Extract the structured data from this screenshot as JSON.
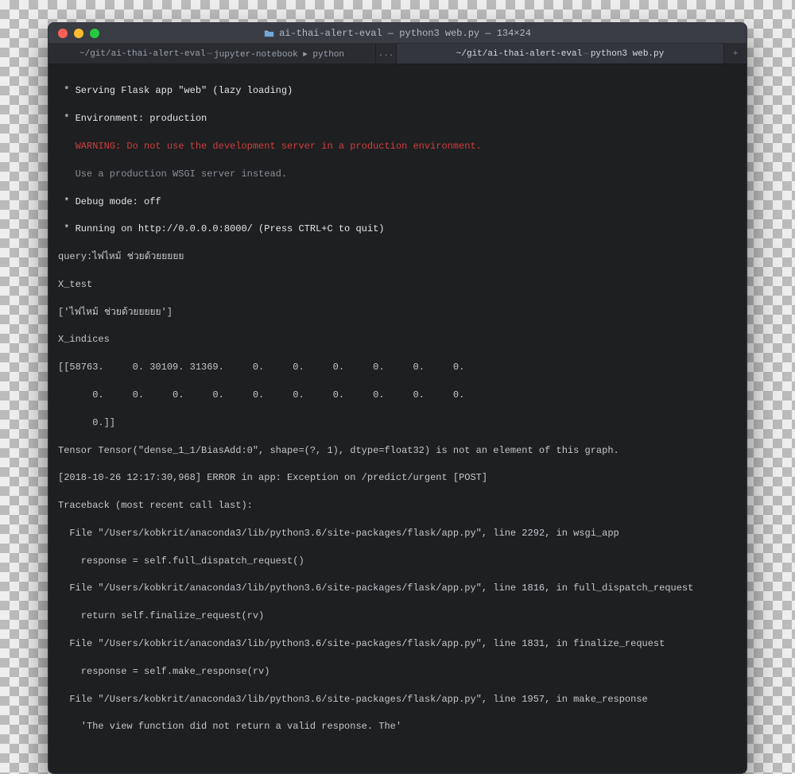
{
  "window": {
    "title_main": "ai-thai-alert-eval — python3 web.py — 134×24"
  },
  "tabs": {
    "left_path": "~/git/ai-thai-alert-eval",
    "left_proc": "jupyter-notebook ▸ python",
    "overflow": "...",
    "right_path": "~/git/ai-thai-alert-eval",
    "right_proc": "python3 web.py"
  },
  "terminal": {
    "l01": " * Serving Flask app \"web\" (lazy loading)",
    "l02": " * Environment: production",
    "l03": "   WARNING: Do not use the development server in a production environment.",
    "l04": "   Use a production WSGI server instead.",
    "l05": " * Debug mode: off",
    "l06": " * Running on http://0.0.0.0:8000/ (Press CTRL+C to quit)",
    "l07": "query:ไฟไหม้ ช่วยด้วยยยยย",
    "l08": "X_test",
    "l09": "['ไฟไหม้ ช่วยด้วยยยยย']",
    "l10": "X_indices",
    "l11": "[[58763.     0. 30109. 31369.     0.     0.     0.     0.     0.     0.",
    "l12": "      0.     0.     0.     0.     0.     0.     0.     0.     0.     0.",
    "l13": "      0.]]",
    "l14": "Tensor Tensor(\"dense_1_1/BiasAdd:0\", shape=(?, 1), dtype=float32) is not an element of this graph.",
    "l15": "[2018-10-26 12:17:30,968] ERROR in app: Exception on /predict/urgent [POST]",
    "l16": "Traceback (most recent call last):",
    "l17": "  File \"/Users/kobkrit/anaconda3/lib/python3.6/site-packages/flask/app.py\", line 2292, in wsgi_app",
    "l18": "    response = self.full_dispatch_request()",
    "l19": "  File \"/Users/kobkrit/anaconda3/lib/python3.6/site-packages/flask/app.py\", line 1816, in full_dispatch_request",
    "l20": "    return self.finalize_request(rv)",
    "l21": "  File \"/Users/kobkrit/anaconda3/lib/python3.6/site-packages/flask/app.py\", line 1831, in finalize_request",
    "l22": "    response = self.make_response(rv)",
    "l23": "  File \"/Users/kobkrit/anaconda3/lib/python3.6/site-packages/flask/app.py\", line 1957, in make_response",
    "l24": "    'The view function did not return a valid response. The'"
  }
}
